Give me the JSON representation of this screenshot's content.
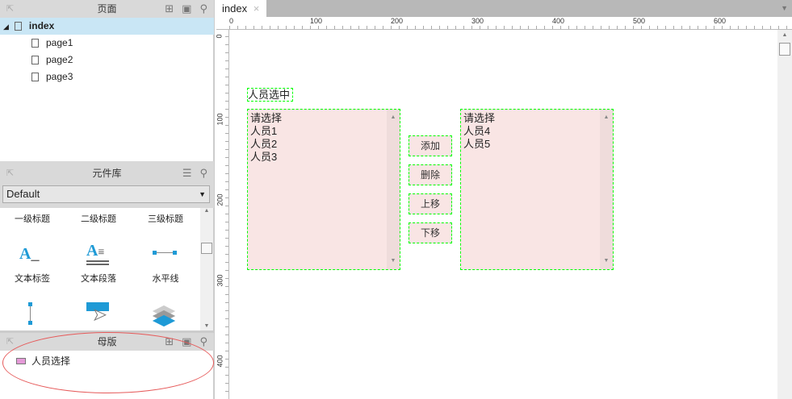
{
  "pages_panel": {
    "title": "页面",
    "items": [
      {
        "label": "index",
        "selected": true
      },
      {
        "label": "page1"
      },
      {
        "label": "page2"
      },
      {
        "label": "page3"
      }
    ]
  },
  "library_panel": {
    "title": "元件库",
    "dropdown": "Default",
    "items": [
      "一级标题",
      "二级标题",
      "三级标题",
      "文本标签",
      "文本段落",
      "水平线"
    ]
  },
  "masters_panel": {
    "title": "母版",
    "items": [
      "人员选择"
    ]
  },
  "tab": {
    "label": "index",
    "close": "×"
  },
  "ruler": {
    "h": [
      "0",
      "100",
      "200",
      "300",
      "400",
      "500",
      "600"
    ],
    "v": [
      "0",
      "100",
      "200",
      "300",
      "400"
    ]
  },
  "canvas": {
    "label": "人员选中",
    "left_list": [
      "请选择",
      "人员1",
      "人员2",
      "人员3"
    ],
    "right_list": [
      "请选择",
      "人员4",
      "人员5"
    ],
    "buttons": [
      "添加",
      "删除",
      "上移",
      "下移"
    ]
  },
  "colors": {
    "selection": "#c9e6f5",
    "widget_fill": "#f9e5e4",
    "widget_border": "#00ff00",
    "accent": "#1e9ad6"
  }
}
